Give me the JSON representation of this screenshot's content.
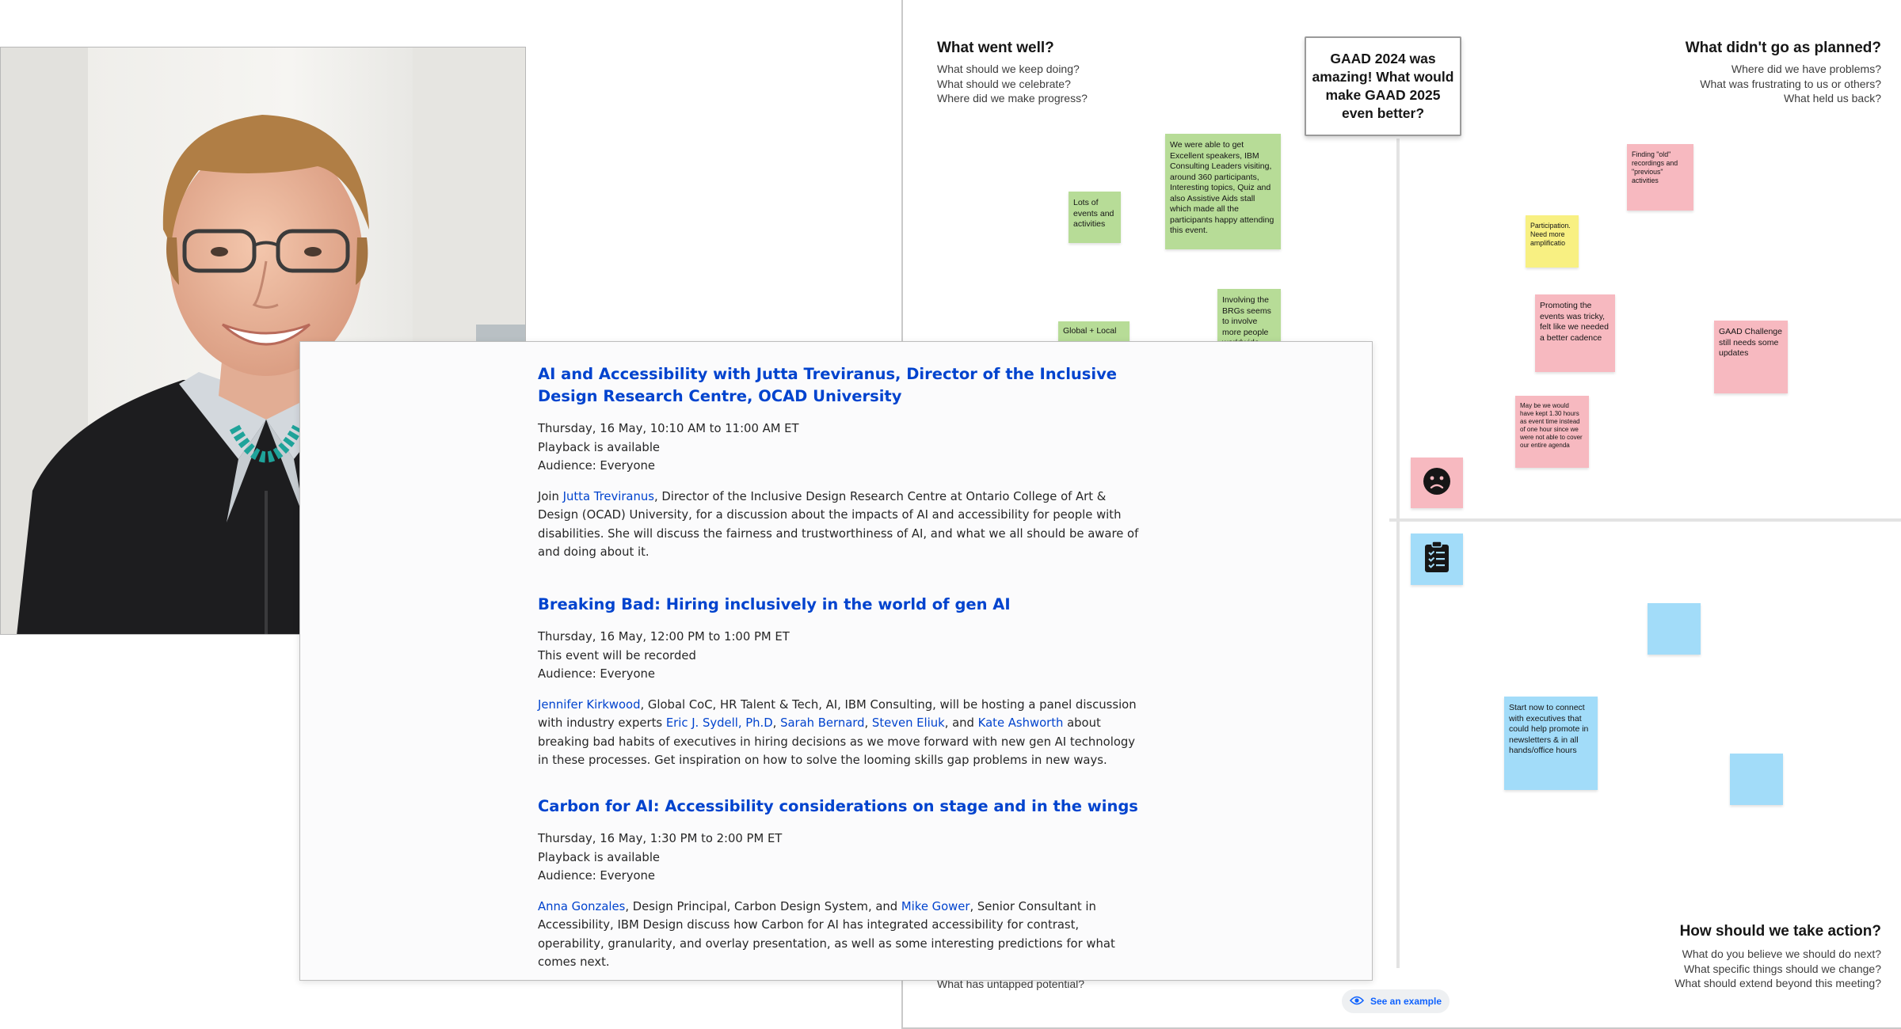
{
  "board": {
    "central_card": "GAAD 2024 was amazing! What would make GAAD 2025 even better?",
    "quadrants": {
      "went_well": {
        "title": "What went well?",
        "prompts": [
          "What should we keep doing?",
          "What should we celebrate?",
          "Where did we make progress?"
        ]
      },
      "not_planned": {
        "title": "What didn't go as planned?",
        "prompts": [
          "Where did we have problems?",
          "What was frustrating to us or others?",
          "What held us back?"
        ]
      },
      "take_action": {
        "title": "How should we take action?",
        "prompts": [
          "What do you believe we should do next?",
          "What specific things should we change?",
          "What should extend beyond this meeting?"
        ]
      },
      "potential_partial": "What has untapped potential?"
    },
    "notes": {
      "excellent_speakers": "We were able to get Excellent speakers, IBM Consulting Leaders visiting, around 360 participants, Interesting topics, Quiz and also Assistive Aids stall which made all the participants happy attending this event.",
      "lots_events": "Lots of events and activities",
      "global_local": "Global + Local",
      "involving_brgs": "Involving the BRGs seems to involve more people worldwide",
      "finding_old": "Finding \"old\" recordings and \"previous\" activities",
      "participation": "Participation. Need more amplificatio",
      "promoting": "Promoting the events was tricky, felt like we needed a better cadence",
      "gaad_challenge": "GAAD Challenge still needs some updates",
      "kept_hours": "May be we would have kept 1.30 hours as event time instead of one hour since we were not able to cover our entire agenda",
      "start_now": "Start now to connect with executives that could help promote in newsletters & in all hands/office hours"
    },
    "icons": {
      "sad": "sad-face-icon",
      "checklist": "clipboard-checklist-icon",
      "eye": "eye-icon"
    },
    "see_example": "See an example",
    "colors": {
      "green": "#b7dc97",
      "yellow": "#f8f082",
      "pink": "#f7b9c0",
      "blue": "#a2dcf9",
      "link": "#0043ce"
    }
  },
  "events": [
    {
      "title": "AI and Accessibility with Jutta Treviranus, Director of the Inclusive Design Research Centre, OCAD University",
      "meta": [
        "Thursday, 16 May, 10:10 AM to 11:00 AM ET",
        "Playback is available",
        "Audience: Everyone"
      ],
      "desc": [
        {
          "t": "Join "
        },
        {
          "t": "Jutta Treviranus",
          "link": true
        },
        {
          "t": ", Director of the Inclusive Design Research Centre at Ontario College of Art & Design (OCAD) University, for a discussion about the impacts of AI and accessibility for people with disabilities. She will discuss the fairness and trustworthiness of AI, and what we all should be aware of and doing about it."
        }
      ]
    },
    {
      "title": "Breaking Bad: Hiring inclusively in the world of gen AI",
      "meta": [
        "Thursday, 16 May, 12:00 PM to 1:00 PM ET",
        "This event will be recorded",
        "Audience: Everyone"
      ],
      "desc": [
        {
          "t": "Jennifer Kirkwood",
          "link": true
        },
        {
          "t": ", Global CoC, HR Talent & Tech, AI, IBM Consulting, will be hosting a panel discussion with industry experts "
        },
        {
          "t": "Eric J. Sydell, Ph.D",
          "link": true
        },
        {
          "t": ", "
        },
        {
          "t": "Sarah Bernard",
          "link": true
        },
        {
          "t": ", "
        },
        {
          "t": "Steven Eliuk",
          "link": true
        },
        {
          "t": ", and "
        },
        {
          "t": "Kate Ashworth",
          "link": true
        },
        {
          "t": " about breaking bad habits of executives in hiring decisions as we move forward with new gen AI technology in these processes. Get inspiration on how to solve the looming skills gap problems in new ways."
        }
      ]
    },
    {
      "title": "Carbon for AI: Accessibility considerations on stage and in the wings",
      "meta": [
        "Thursday, 16 May, 1:30 PM to 2:00 PM ET",
        "Playback is available",
        "Audience: Everyone"
      ],
      "desc": [
        {
          "t": "Anna Gonzales",
          "link": true
        },
        {
          "t": ", Design Principal, Carbon Design System, and "
        },
        {
          "t": "Mike Gower",
          "link": true
        },
        {
          "t": ", Senior Consultant in Accessibility, IBM Design discuss how Carbon for AI has integrated accessibility for contrast, operability, granularity, and overlay presentation, as well as some interesting predictions for what comes next."
        }
      ]
    }
  ]
}
